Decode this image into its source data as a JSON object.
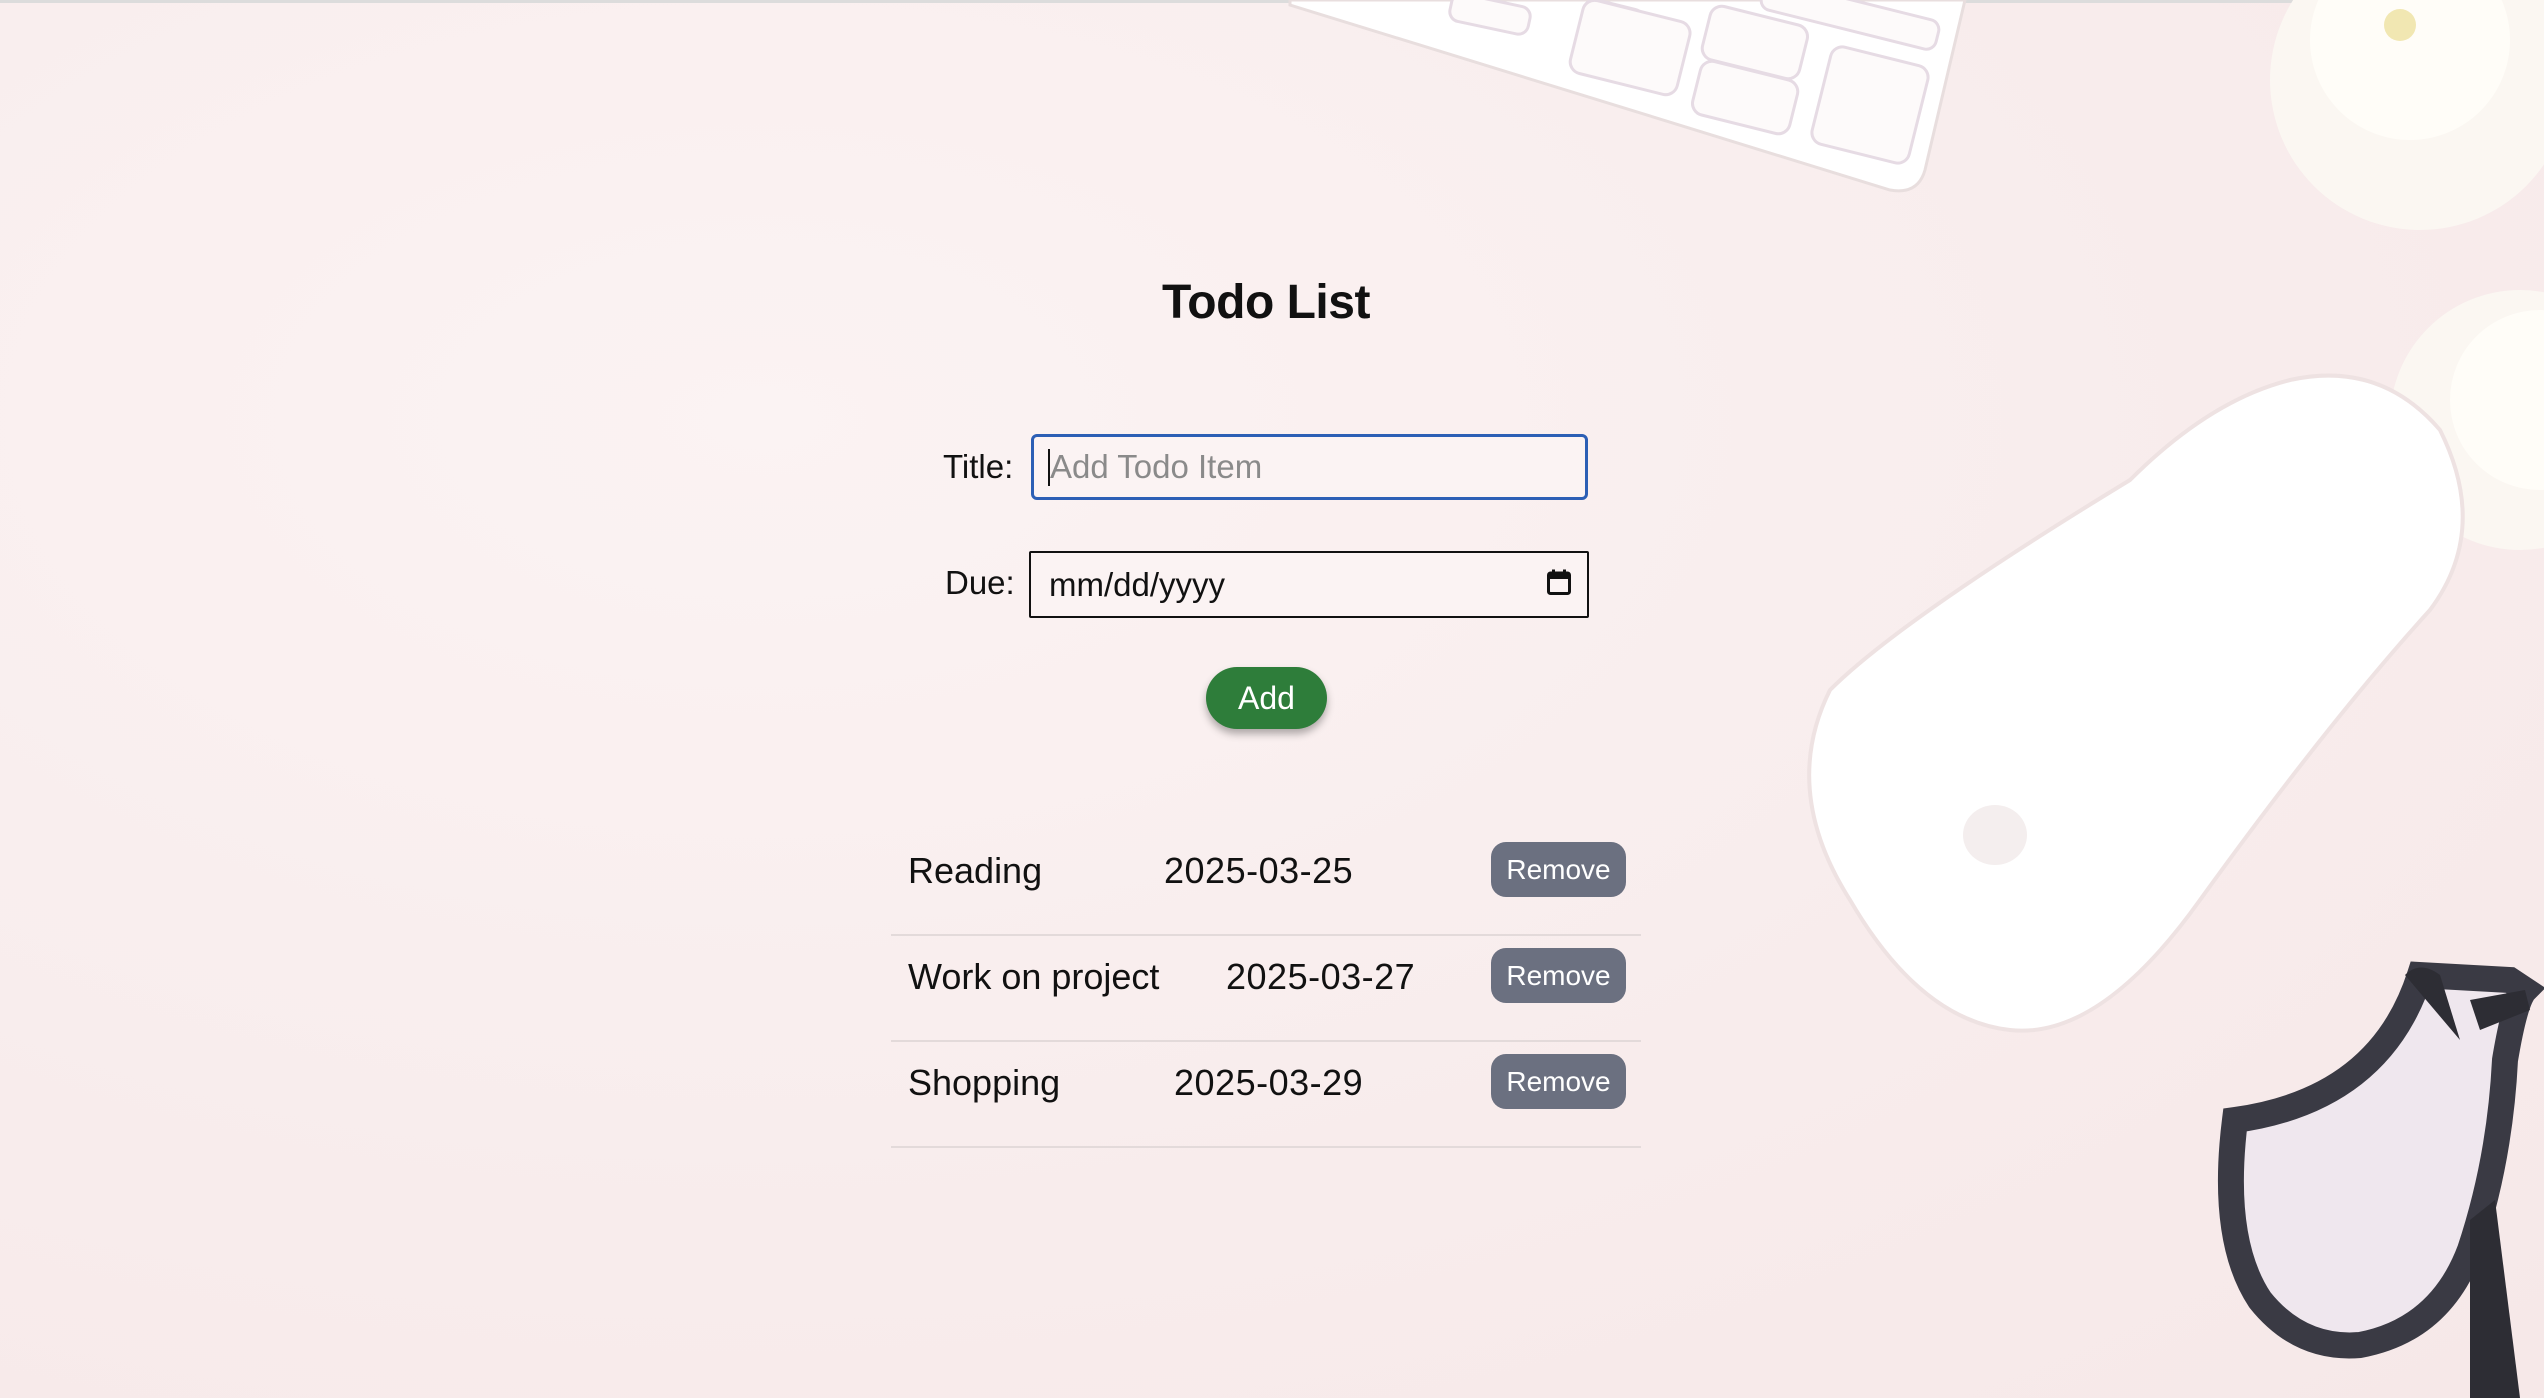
{
  "page": {
    "title": "Todo List"
  },
  "form": {
    "title_label": "Title:",
    "title_placeholder": "Add Todo Item",
    "title_value": "",
    "due_label": "Due:",
    "due_placeholder": "mm/dd/yyyy",
    "add_label": "Add"
  },
  "todos": [
    {
      "title": "Reading",
      "due": "2025-03-25",
      "remove_label": "Remove"
    },
    {
      "title": "Work on project",
      "due": "2025-03-27",
      "remove_label": "Remove"
    },
    {
      "title": "Shopping",
      "due": "2025-03-29",
      "remove_label": "Remove"
    }
  ],
  "colors": {
    "add_button": "#2e7d3a",
    "remove_button": "#6b7080",
    "focus_border": "#2c5fb5",
    "background": "#f9eeee"
  },
  "icons": {
    "date_picker": "calendar-icon"
  }
}
